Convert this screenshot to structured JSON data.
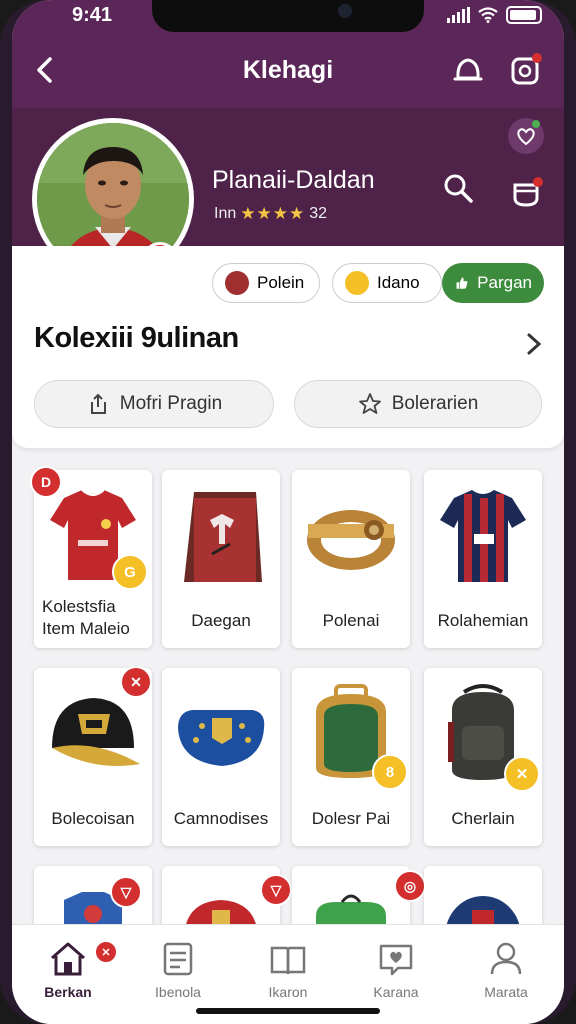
{
  "status": {
    "time": "9:41"
  },
  "header": {
    "title": "Klehagi",
    "back_icon": "back-chevron-icon",
    "icons": [
      "bell-icon",
      "notification-box-icon"
    ]
  },
  "profile": {
    "name": "Planaii-Daldan",
    "rating_prefix": "Inn",
    "stars": "★★★★",
    "rating_value": "32",
    "right_icons": [
      "heart-badge-icon",
      "search-icon",
      "cart-icon"
    ]
  },
  "chips": [
    {
      "label": "Polein",
      "icon": "badge-icon"
    },
    {
      "label": "Idano",
      "icon": "handshake-icon"
    },
    {
      "label": "Pargan",
      "icon": "thumbs-up-icon"
    }
  ],
  "collection": {
    "title": "Kolexiii 9ulinan",
    "buttons": [
      {
        "label": "Mofri Pragin",
        "icon": "share-box-icon"
      },
      {
        "label": "Bolerarien",
        "icon": "star-outline-icon"
      }
    ]
  },
  "items": [
    {
      "label": "Kolestsfia Item Maleio",
      "art": "red-jersey",
      "top_badge": "D",
      "gold_badge": "G"
    },
    {
      "label": "Daegan",
      "art": "framed-shirt"
    },
    {
      "label": "Polenai",
      "art": "leather-armband"
    },
    {
      "label": "Rolahemian",
      "art": "striped-jersey"
    },
    {
      "label": "Bolecoisan",
      "art": "black-cap",
      "top_badge": "✕"
    },
    {
      "label": "Camnodises",
      "art": "blue-pennant"
    },
    {
      "label": "Dolesr Pai",
      "art": "green-bag",
      "gold_badge": "8"
    },
    {
      "label": "Cherlain",
      "art": "dark-backpack",
      "gold_badge": "✕"
    }
  ],
  "tabs": [
    {
      "label": "Berkan",
      "icon": "home-icon",
      "active": true
    },
    {
      "label": "Ibenola",
      "icon": "list-icon"
    },
    {
      "label": "Ikaron",
      "icon": "book-icon"
    },
    {
      "label": "Karana",
      "icon": "chat-heart-icon"
    },
    {
      "label": "Marata",
      "icon": "person-icon"
    }
  ],
  "colors": {
    "header": "#5a2758",
    "accent_green": "#3d8b3d",
    "badge_red": "#d32f2f",
    "badge_gold": "#f4c025"
  }
}
